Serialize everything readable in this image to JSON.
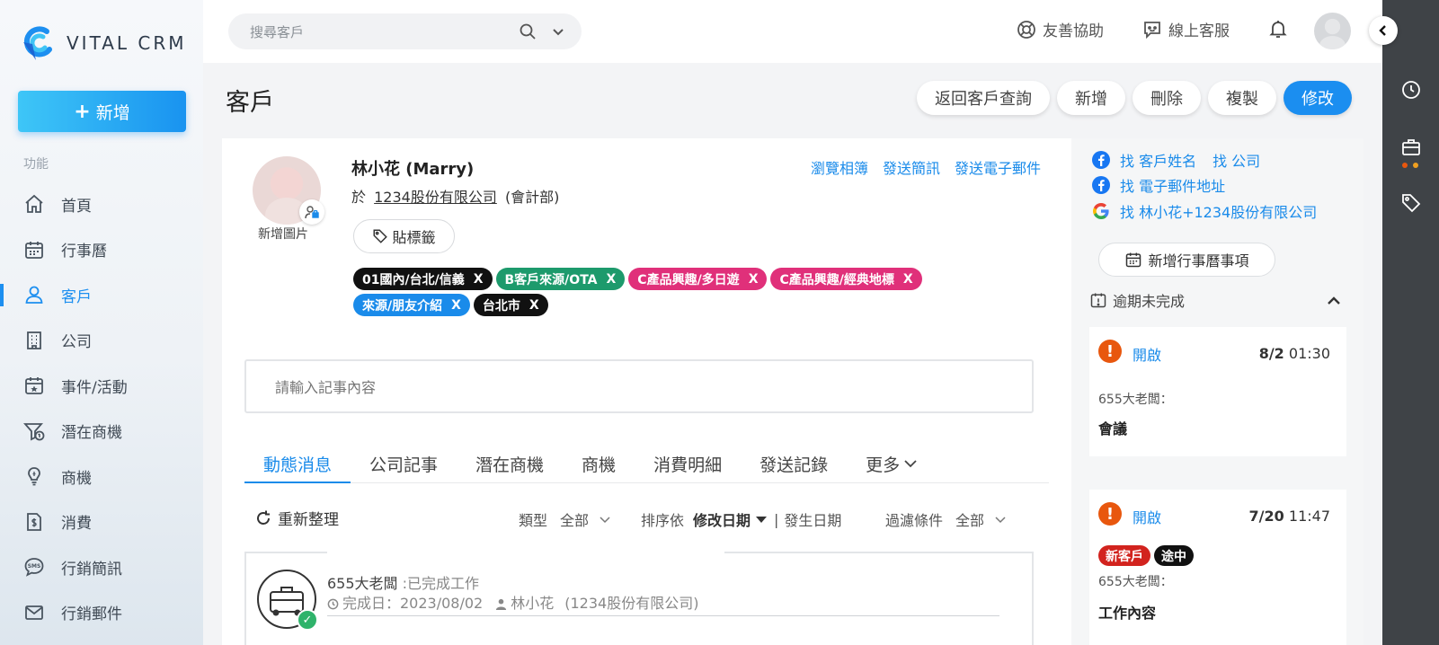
{
  "app": {
    "brand": "VITAL CRM"
  },
  "sidebar": {
    "add_label": "新增",
    "section_label": "功能",
    "items": [
      {
        "label": "首頁",
        "icon": "home-icon"
      },
      {
        "label": "行事曆",
        "icon": "calendar-icon"
      },
      {
        "label": "客戶",
        "icon": "customer-icon",
        "active": true
      },
      {
        "label": "公司",
        "icon": "building-icon"
      },
      {
        "label": "事件/活動",
        "icon": "event-icon"
      },
      {
        "label": "潛在商機",
        "icon": "funnel-icon"
      },
      {
        "label": "商機",
        "icon": "lightbulb-icon"
      },
      {
        "label": "消費",
        "icon": "receipt-icon"
      },
      {
        "label": "行銷簡訊",
        "icon": "sms-icon"
      },
      {
        "label": "行銷郵件",
        "icon": "mail-icon"
      }
    ]
  },
  "header": {
    "search_placeholder": "搜尋客戶",
    "help_label": "友善協助",
    "support_label": "線上客服"
  },
  "page": {
    "title": "客戶",
    "actions": [
      "返回客戶查詢",
      "新增",
      "刪除",
      "複製",
      "修改"
    ]
  },
  "customer": {
    "add_photo": "新增圖片",
    "name": "林小花 (Marry)",
    "company_prefix": "於",
    "company": "1234股份有限公司",
    "department": "(會計部)",
    "links": [
      "瀏覽相簿",
      "發送簡訊",
      "發送電子郵件"
    ],
    "tag_button": "貼標籤",
    "tags": [
      {
        "label": "01國內/台北/信義",
        "color": "#111111"
      },
      {
        "label": "B客戶來源/OTA",
        "color": "#1d9a6c"
      },
      {
        "label": "C產品興趣/多日遊",
        "color": "#e0307a"
      },
      {
        "label": "C產品興趣/經典地標",
        "color": "#e0307a"
      },
      {
        "label": "來源/朋友介紹",
        "color": "#1a8bea"
      },
      {
        "label": "台北市",
        "color": "#111111"
      }
    ],
    "tag_remove": "X"
  },
  "note": {
    "placeholder": "請輸入記事內容"
  },
  "tabs": [
    "動態消息",
    "公司記事",
    "潛在商機",
    "商機",
    "消費明細",
    "發送記錄",
    "更多"
  ],
  "toolbar": {
    "refresh": "重新整理",
    "type_label": "類型",
    "type_value": "全部",
    "sort_label": "排序依",
    "sort_active": "修改日期",
    "sort_sep": "|",
    "sort_other": "發生日期",
    "filter_label": "過濾條件",
    "filter_value": "全部"
  },
  "feed": {
    "owner": "655大老闆",
    "action": ":已完成工作",
    "done_label": "完成日：2023/08/02",
    "person": "林小花",
    "company": "(1234股份有限公司)"
  },
  "side": {
    "find_rows": [
      {
        "icon": "facebook-icon",
        "items": [
          "找 客戶姓名",
          "找 公司"
        ]
      },
      {
        "icon": "facebook-icon",
        "items": [
          "找 電子郵件地址"
        ]
      },
      {
        "icon": "google-icon",
        "items": [
          "找 林小花+1234股份有限公司"
        ]
      }
    ],
    "calendar_btn": "新增行事曆事項",
    "overdue_label": "逾期未完成",
    "events": [
      {
        "status": "開啟",
        "date": "8/2",
        "time": "01:30",
        "owner": "655大老闆：",
        "title": "會議",
        "tags": []
      },
      {
        "status": "開啟",
        "date": "7/20",
        "time": "11:47",
        "owner": "655大老闆：",
        "title": "工作內容",
        "tags": [
          {
            "label": "新客戶",
            "color": "#d2231e"
          },
          {
            "label": "途中",
            "color": "#111111"
          }
        ]
      }
    ]
  }
}
